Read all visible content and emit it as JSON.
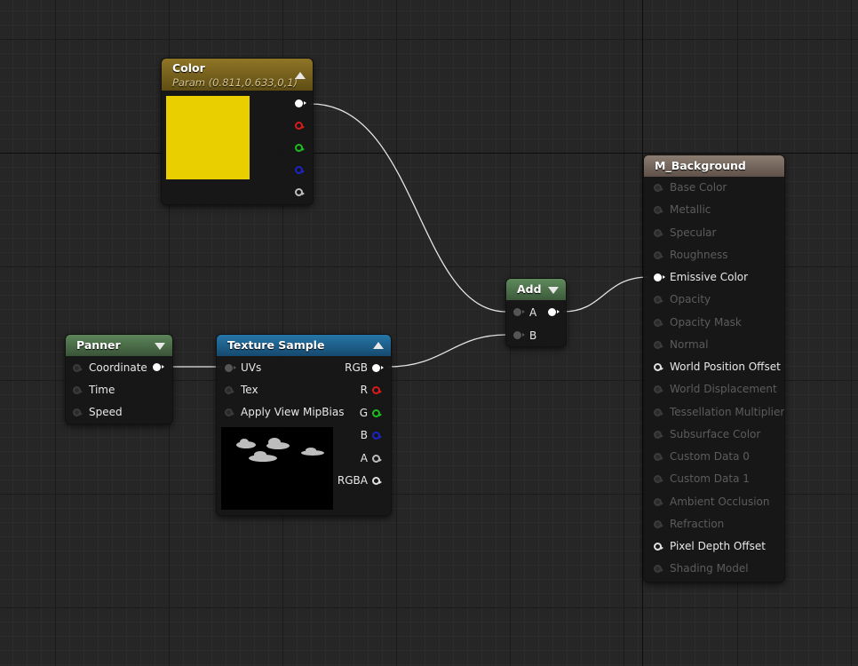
{
  "colors": {
    "color_header": "#7a6420",
    "green_header": "#4c6e4a",
    "texture_header": "#1c5e8a",
    "result_header": "#7c6d62",
    "swatch": "#e9cf00"
  },
  "color_node": {
    "title": "Color",
    "subtitle": "Param (0.811,0.633,0,1)",
    "swatch_hex": "#e9cf00",
    "outputs": [
      {
        "name": "rgb-output-pin",
        "style": "filled-white"
      },
      {
        "name": "r-output-pin",
        "style": "hollow-red"
      },
      {
        "name": "g-output-pin",
        "style": "hollow-green"
      },
      {
        "name": "b-output-pin",
        "style": "hollow-blue"
      },
      {
        "name": "a-output-pin",
        "style": "hollow-gray"
      }
    ]
  },
  "add_node": {
    "title": "Add",
    "inputs": [
      {
        "label": "A",
        "name": "a-input-pin"
      },
      {
        "label": "B",
        "name": "b-input-pin"
      }
    ]
  },
  "panner_node": {
    "title": "Panner",
    "inputs": [
      {
        "label": "Coordinate",
        "name": "coordinate-pin"
      },
      {
        "label": "Time",
        "name": "time-pin"
      },
      {
        "label": "Speed",
        "name": "speed-pin"
      }
    ]
  },
  "texture_node": {
    "title": "Texture Sample",
    "inputs": [
      {
        "label": "UVs"
      },
      {
        "label": "Tex"
      },
      {
        "label": "Apply View MipBias"
      }
    ],
    "outputs": [
      {
        "label": "RGB",
        "style": "filled-white"
      },
      {
        "label": "R",
        "style": "hollow-red"
      },
      {
        "label": "G",
        "style": "hollow-green"
      },
      {
        "label": "B",
        "style": "hollow-blue"
      },
      {
        "label": "A",
        "style": "hollow-gray"
      },
      {
        "label": "RGBA",
        "style": "hollow-white"
      }
    ]
  },
  "result_node": {
    "title": "M_Background",
    "inputs": [
      {
        "label": "Base Color",
        "active": false,
        "pin": "dim-circle"
      },
      {
        "label": "Metallic",
        "active": false,
        "pin": "dim-circle"
      },
      {
        "label": "Specular",
        "active": false,
        "pin": "dim-circle"
      },
      {
        "label": "Roughness",
        "active": false,
        "pin": "dim-circle"
      },
      {
        "label": "Emissive Color",
        "active": true,
        "pin": "filled-white"
      },
      {
        "label": "Opacity",
        "active": false,
        "pin": "dim-circle"
      },
      {
        "label": "Opacity Mask",
        "active": false,
        "pin": "dim-circle"
      },
      {
        "label": "Normal",
        "active": false,
        "pin": "dim-circle"
      },
      {
        "label": "World Position Offset",
        "active": true,
        "pin": "hollow-white"
      },
      {
        "label": "World Displacement",
        "active": false,
        "pin": "dim-circle"
      },
      {
        "label": "Tessellation Multiplier",
        "active": false,
        "pin": "dim-circle"
      },
      {
        "label": "Subsurface Color",
        "active": false,
        "pin": "dim-circle"
      },
      {
        "label": "Custom Data 0",
        "active": false,
        "pin": "dim-circle"
      },
      {
        "label": "Custom Data 1",
        "active": false,
        "pin": "dim-circle"
      },
      {
        "label": "Ambient Occlusion",
        "active": false,
        "pin": "dim-circle"
      },
      {
        "label": "Refraction",
        "active": false,
        "pin": "dim-circle"
      },
      {
        "label": "Pixel Depth Offset",
        "active": true,
        "pin": "hollow-white"
      },
      {
        "label": "Shading Model",
        "active": false,
        "pin": "dim-circle"
      }
    ]
  }
}
